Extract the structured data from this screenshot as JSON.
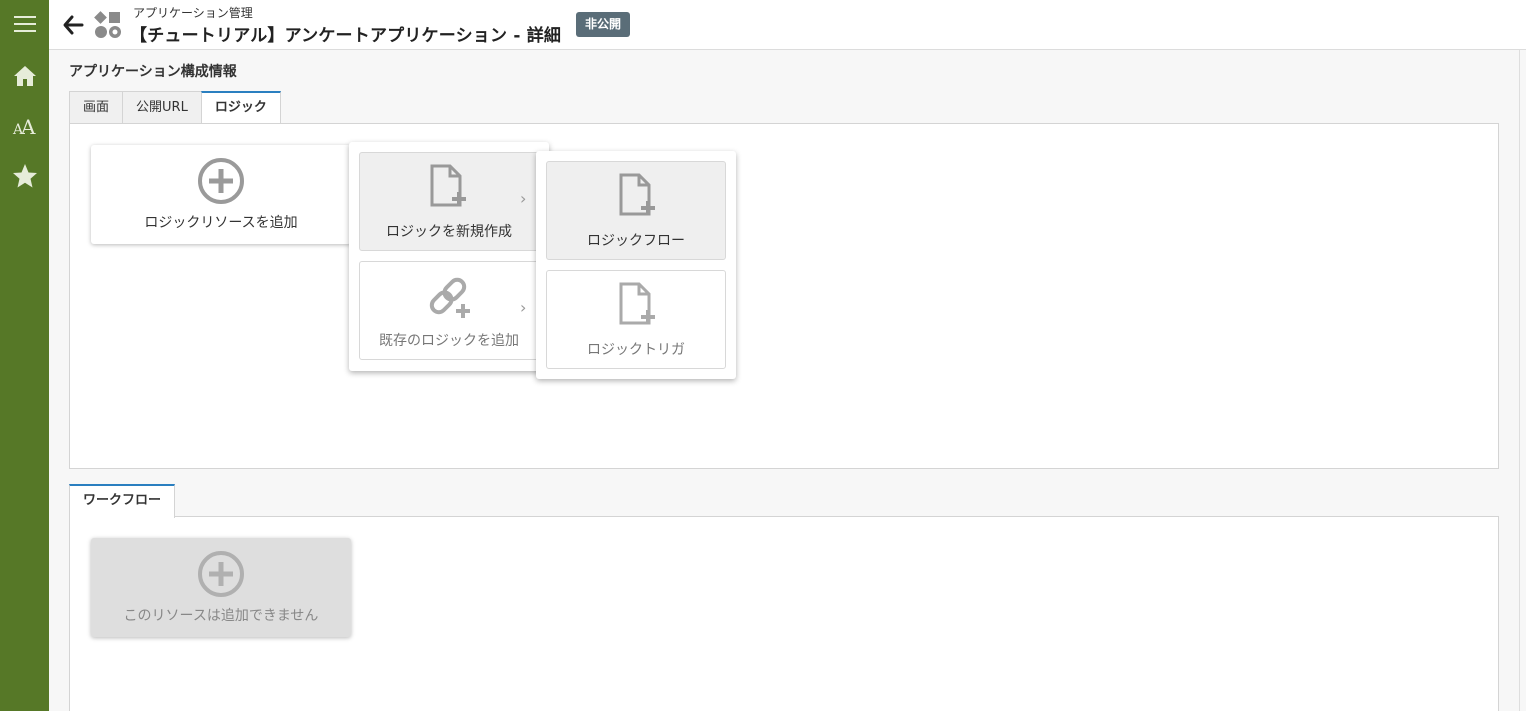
{
  "header": {
    "breadcrumb": "アプリケーション管理",
    "title": "【チュートリアル】アンケートアプリケーション - 詳細",
    "status_badge": "非公開"
  },
  "section_title": "アプリケーション構成情報",
  "tabs": [
    {
      "label": "画面",
      "active": false
    },
    {
      "label": "公開URL",
      "active": false
    },
    {
      "label": "ロジック",
      "active": true
    }
  ],
  "logic_panel": {
    "add_card_label": "ロジックリソースを追加",
    "menu1": {
      "new_label": "ロジックを新規作成",
      "existing_label": "既存のロジックを追加"
    },
    "menu2": {
      "flow_label": "ロジックフロー",
      "trigger_label": "ロジックトリガ"
    }
  },
  "workflow": {
    "tab_label": "ワークフロー",
    "card_label": "このリソースは追加できません"
  },
  "colors": {
    "sidebar": "#567827",
    "tab_accent": "#2a7fc0",
    "badge": "#5a6d78"
  },
  "icons": {
    "sidebar": [
      "menu-icon",
      "home-icon",
      "font-size-icon",
      "star-icon"
    ],
    "header": [
      "back-arrow-icon",
      "app-manage-icon"
    ]
  }
}
